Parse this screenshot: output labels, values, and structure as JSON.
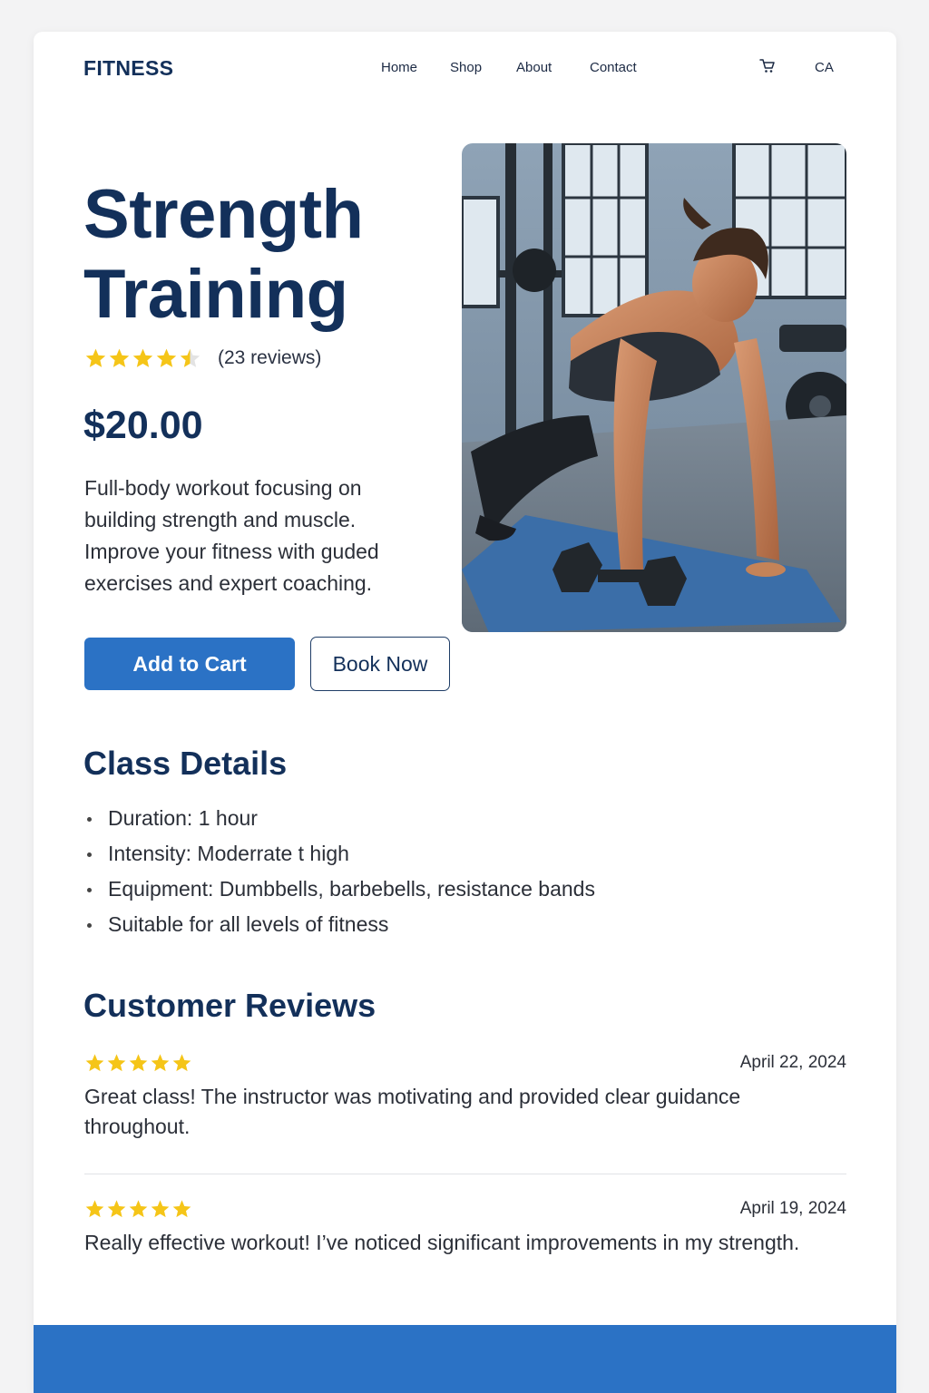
{
  "brand": {
    "logo": "FITNESS"
  },
  "nav": {
    "links": [
      "Home",
      "Shop",
      "About",
      "Contact"
    ],
    "cart_icon": "cart-icon",
    "locale": "CA"
  },
  "product": {
    "title": "Strength Training",
    "rating": 4.5,
    "review_count_label": "(23 reviews)",
    "price": "$20.00",
    "description": "Full-body workout focusing on building strength and muscle. Improve your fitness with guded exercises and expert coaching.",
    "add_to_cart_label": "Add to Cart",
    "book_now_label": "Book Now"
  },
  "class_details": {
    "heading": "Class Details",
    "items": [
      "Duration: 1 hour",
      "Intensity: Moderrate t high",
      "Equipment: Dumbbells, barbebells, resistance bands",
      "Suitable for all levels of fitness"
    ]
  },
  "reviews": {
    "heading": "Customer Reviews",
    "items": [
      {
        "rating": 5,
        "date": "April 22, 2024",
        "text": "Great class!  The instructor was motivating and provided clear guidance throughout."
      },
      {
        "rating": 5,
        "date": "April 19, 2024",
        "text": "Really effective workout! I’ve noticed significant improvements in my strength."
      }
    ]
  },
  "colors": {
    "primary": "#2b72c5",
    "heading": "#13305a",
    "star": "#f5c518"
  }
}
